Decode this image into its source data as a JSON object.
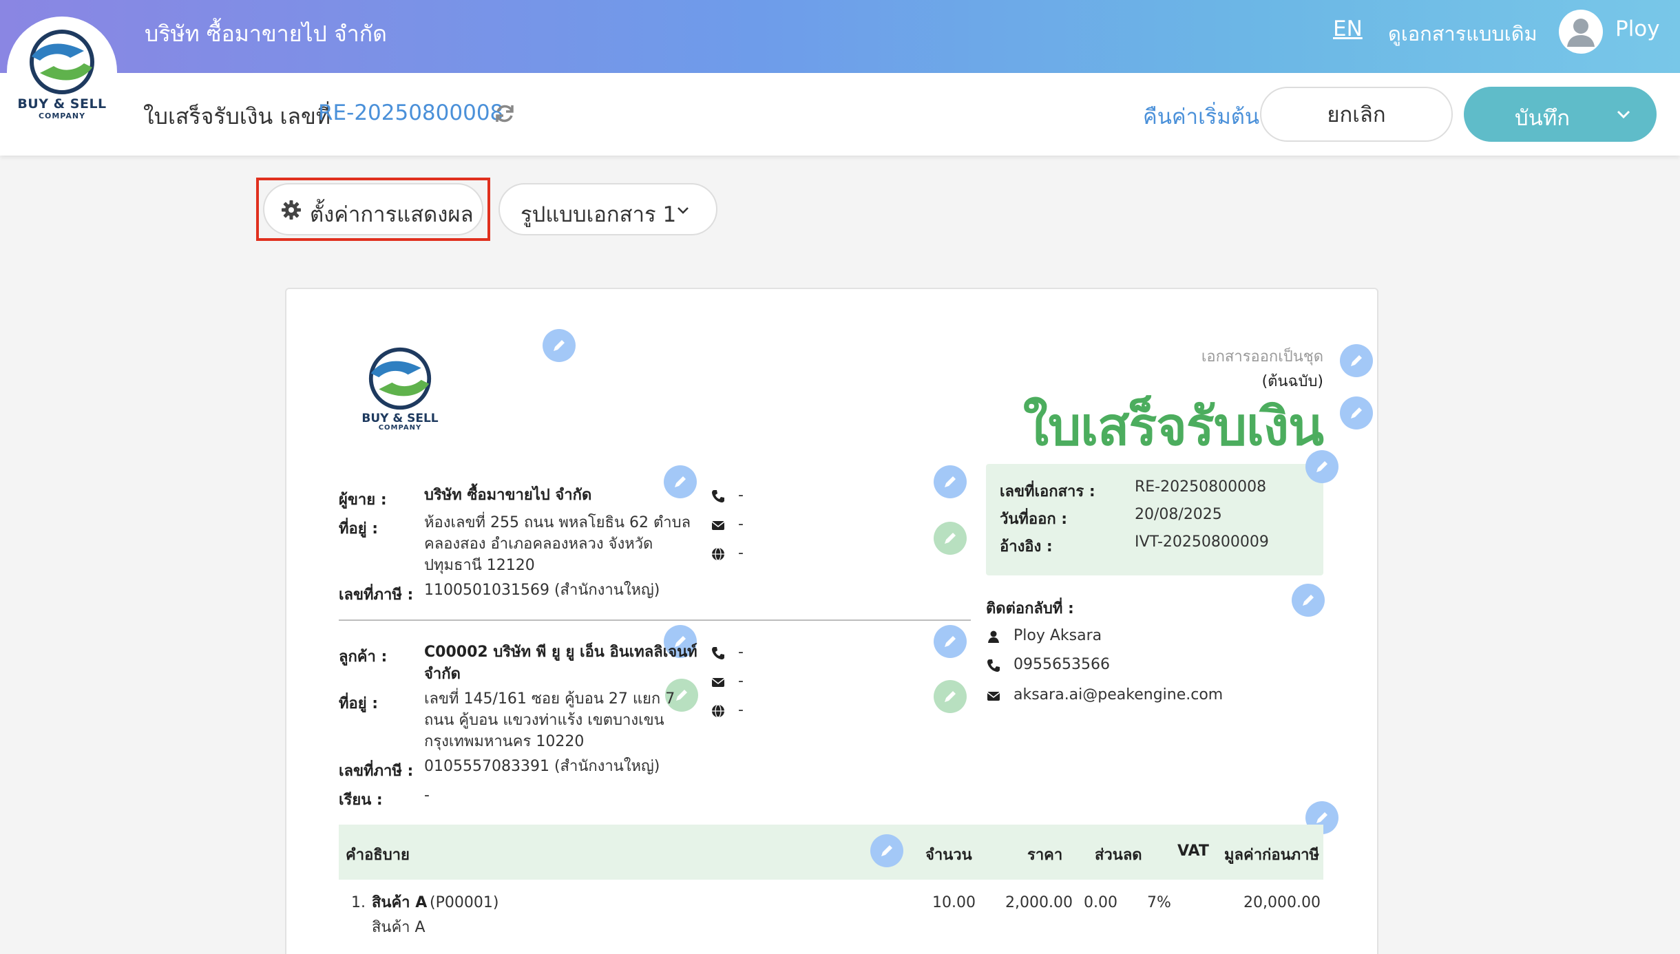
{
  "header": {
    "company_name": "บริษัท ซื้อมาขายไป จำกัด",
    "language": "EN",
    "old_doc_link": "ดูเอกสารแบบเดิม",
    "user_name": "Ploy",
    "logo_name": "BUY & SELL",
    "logo_sub": "COMPANY"
  },
  "subheader": {
    "doc_heading": "ใบเสร็จรับเงิน เลขที่",
    "doc_number": "RE-20250800008",
    "reset_label": "คืนค่าเริ่มต้น",
    "cancel_label": "ยกเลิก",
    "save_label": "บันทึก"
  },
  "toolbar": {
    "display_settings_label": "ตั้งค่าการแสดงผล",
    "template_label": "รูปแบบเอกสาร 1"
  },
  "document": {
    "set_note": "เอกสารออกเป็นชุด",
    "original_note": "(ต้นฉบับ)",
    "title": "ใบเสร็จรับเงิน",
    "seller": {
      "label": "ผู้ขาย :",
      "name": "บริษัท ซื้อมาขายไป จำกัด",
      "address_label": "ที่อยู่ :",
      "address_lines": [
        "ห้องเลขที่ 255 ถนน พหลโยธิน 62 ตำบล",
        "คลองสอง อำเภอคลองหลวง จังหวัด",
        "ปทุมธานี 12120"
      ],
      "tax_label": "เลขที่ภาษี :",
      "tax_id": "1100501031569 (สำนักงานใหญ่)",
      "phone": "-",
      "email": "-",
      "web": "-"
    },
    "customer": {
      "label": "ลูกค้า :",
      "name_lines": [
        "C00002 บริษัท พี ยู ยู เอ็น อินเทลลิเจนท์",
        "จำกัด"
      ],
      "address_label": "ที่อยู่ :",
      "address_lines": [
        "เลขที่ 145/161    ซอย คู้บอน 27 แยก 7",
        "ถนน คู้บอน  แขวงท่าแร้ง เขตบางเขน",
        "กรุงเทพมหานคร 10220"
      ],
      "tax_label": "เลขที่ภาษี :",
      "tax_id": "0105557083391 (สำนักงานใหญ่)",
      "attn_label": "เรียน :",
      "attn": "-",
      "phone": "-",
      "email": "-",
      "web": "-"
    },
    "info": {
      "doc_no_label": "เลขที่เอกสาร :",
      "doc_no": "RE-20250800008",
      "issue_date_label": "วันที่ออก :",
      "issue_date": "20/08/2025",
      "ref_label": "อ้างอิง :",
      "ref": "IVT-20250800009"
    },
    "contact": {
      "label": "ติดต่อกลับที่ :",
      "name": "Ploy Aksara",
      "phone": "0955653566",
      "email": "aksara.ai@peakengine.com"
    },
    "table": {
      "headers": [
        "คำอธิบาย",
        "จำนวน",
        "ราคา",
        "ส่วนลด",
        "VAT",
        "มูลค่าก่อนภาษี"
      ],
      "rows": [
        {
          "index": "1.",
          "name": "สินค้า A",
          "code": "(P00001)",
          "desc": "สินค้า A",
          "qty": "10.00",
          "price": "2,000.00",
          "discount": "0.00",
          "vat": "7%",
          "amount": "20,000.00"
        }
      ]
    }
  },
  "colors": {
    "accent_blue": "#4a90d9",
    "title_green": "#4cad5e",
    "save_teal": "#5fbcc9",
    "highlight_red": "#e0301e"
  }
}
